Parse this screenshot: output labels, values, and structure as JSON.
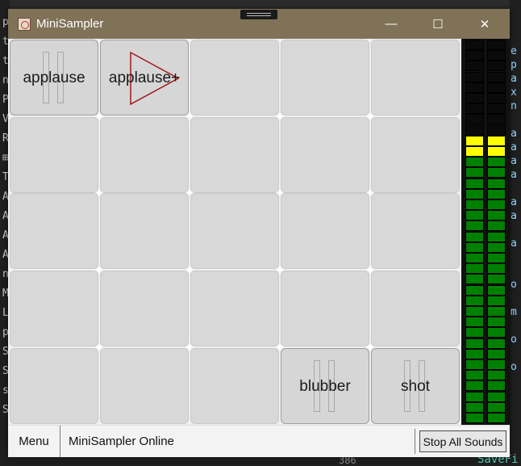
{
  "window": {
    "title": "MiniSampler",
    "controls": {
      "minimize": "—",
      "maximize": "☐",
      "close": "✕"
    }
  },
  "pads": [
    {
      "label": "applause",
      "state": "paused-icon"
    },
    {
      "label": "applause+",
      "state": "play-icon"
    },
    {
      "label": "",
      "state": "empty"
    },
    {
      "label": "",
      "state": "empty"
    },
    {
      "label": "",
      "state": "empty"
    },
    {
      "label": "",
      "state": "empty"
    },
    {
      "label": "",
      "state": "empty"
    },
    {
      "label": "",
      "state": "empty"
    },
    {
      "label": "",
      "state": "empty"
    },
    {
      "label": "",
      "state": "empty"
    },
    {
      "label": "",
      "state": "empty"
    },
    {
      "label": "",
      "state": "empty"
    },
    {
      "label": "",
      "state": "empty"
    },
    {
      "label": "",
      "state": "empty"
    },
    {
      "label": "",
      "state": "empty"
    },
    {
      "label": "",
      "state": "empty"
    },
    {
      "label": "",
      "state": "empty"
    },
    {
      "label": "",
      "state": "empty"
    },
    {
      "label": "",
      "state": "empty"
    },
    {
      "label": "",
      "state": "empty"
    },
    {
      "label": "",
      "state": "empty"
    },
    {
      "label": "",
      "state": "empty"
    },
    {
      "label": "",
      "state": "empty"
    },
    {
      "label": "blubber",
      "state": "paused-icon"
    },
    {
      "label": "shot",
      "state": "paused-icon"
    }
  ],
  "vu_meter": {
    "segments": 36,
    "level_left": 0.75,
    "level_right": 0.75,
    "colors": {
      "off": "#0a0a0a",
      "green": "#008000",
      "yellow": "#ffff00"
    },
    "yellow_segments": 2
  },
  "statusbar": {
    "menu_label": "Menu",
    "status_text": "MiniSampler Online",
    "stop_label": "Stop All Sounds"
  },
  "background": {
    "left_chars": [
      "pe",
      "tr",
      "te",
      "ni",
      "P",
      "V",
      "R",
      "⊞",
      "T",
      "A",
      "A",
      "A",
      "A",
      "n",
      "M",
      "L",
      "p",
      "S",
      "S",
      "s",
      "S"
    ],
    "right_chars": [
      "e",
      "p",
      "a",
      "x",
      "n",
      "",
      "a",
      "a",
      "a",
      "a",
      "",
      "a",
      "a",
      "",
      "a",
      "",
      "",
      "o",
      "",
      "m",
      "",
      "o",
      "",
      "o"
    ],
    "line_number": "386",
    "code_text": "SaveFi"
  }
}
